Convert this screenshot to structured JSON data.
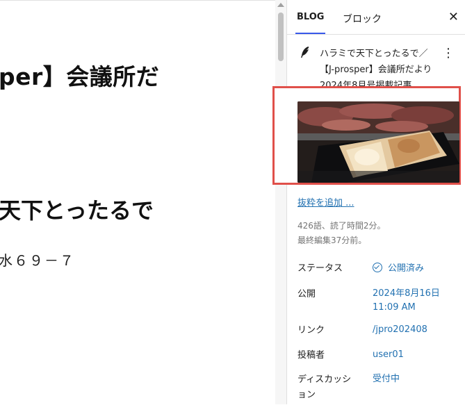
{
  "editor": {
    "heading1": "per】会議所だ",
    "heading2": "天下とったるで",
    "paragraph": "水６９－７"
  },
  "sidebar": {
    "tabs": [
      {
        "label": "BLOG",
        "active": true
      },
      {
        "label": "ブロック",
        "active": false
      }
    ],
    "close_icon": "close-icon",
    "post": {
      "icon": "feather-icon",
      "title": "ハラミで天下とったるで／【J-prosper】会議所だより2024年8月号掲載記事"
    },
    "featured_image": {
      "description": "grilled meat and focaccia bread"
    },
    "excerpt_link": "抜粋を追加 ...",
    "meta": {
      "stats": "426語、読了時間2分。",
      "last_edited": "最終編集37分前。"
    },
    "rows": [
      {
        "label": "ステータス",
        "value": "公開済み"
      },
      {
        "label": "公開",
        "value": "2024年8月16日 11:09 AM"
      },
      {
        "label": "リンク",
        "value": "/jpro202408"
      },
      {
        "label": "投稿者",
        "value": "user01"
      },
      {
        "label": "ディスカッション",
        "value": "受付中"
      }
    ]
  },
  "colors": {
    "accent": "#3858e9",
    "link": "#2271b1",
    "highlight": "#e0504a"
  }
}
